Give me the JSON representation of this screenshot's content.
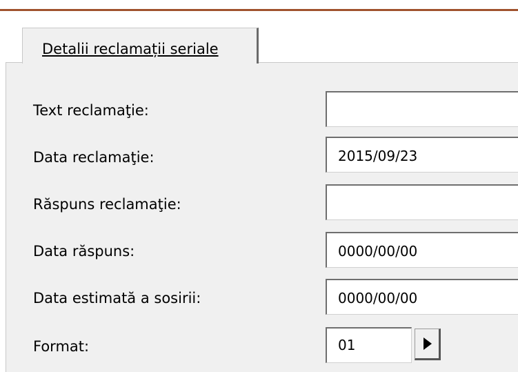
{
  "tab": {
    "label": "Detalii reclamații seriale"
  },
  "rows": [
    {
      "label": "Text reclamaţie:",
      "value": ""
    },
    {
      "label": "Data reclamaţie:",
      "value": "2015/09/23"
    },
    {
      "label": "Răspuns reclamaţie:",
      "value": ""
    },
    {
      "label": "Data răspuns:",
      "value": "0000/00/00"
    },
    {
      "label": "Data estimată a sosirii:",
      "value": "0000/00/00"
    }
  ],
  "format": {
    "label": "Format:",
    "value": "01"
  },
  "icons": {
    "next": "triangle-right-icon"
  },
  "colors": {
    "accent_bar": "#a0522d",
    "panel_bg": "#f0f0f0"
  }
}
